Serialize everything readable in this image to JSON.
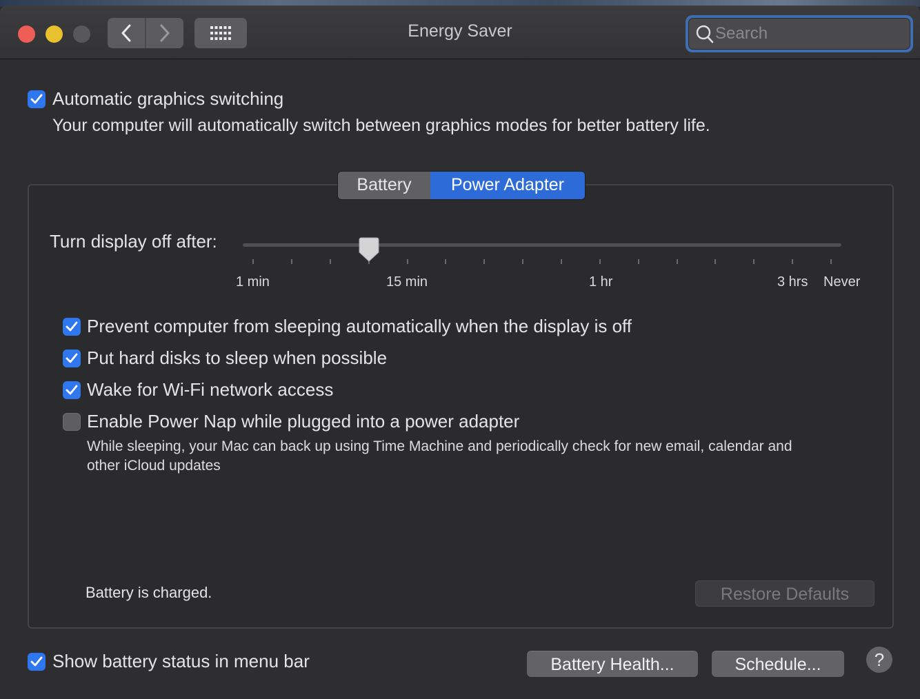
{
  "window": {
    "title": "Energy Saver",
    "search_placeholder": "Search"
  },
  "graphics": {
    "checked": true,
    "label": "Automatic graphics switching",
    "description": "Your computer will automatically switch between graphics modes for better battery life."
  },
  "tabs": [
    {
      "label": "Battery",
      "selected": false
    },
    {
      "label": "Power Adapter",
      "selected": true
    }
  ],
  "display_slider": {
    "label": "Turn display off after:",
    "tick_labels": [
      "1 min",
      "15 min",
      "1 hr",
      "3 hrs",
      "Never"
    ],
    "value": "15 min"
  },
  "options": [
    {
      "label": "Prevent computer from sleeping automatically when the display is off",
      "checked": true
    },
    {
      "label": "Put hard disks to sleep when possible",
      "checked": true
    },
    {
      "label": "Wake for Wi-Fi network access",
      "checked": true
    },
    {
      "label": "Enable Power Nap while plugged into a power adapter",
      "checked": false,
      "description": "While sleeping, your Mac can back up using Time Machine and periodically check for new email, calendar and other iCloud updates"
    }
  ],
  "status_text": "Battery is charged.",
  "buttons": {
    "restore_defaults": "Restore Defaults",
    "battery_health": "Battery Health...",
    "schedule": "Schedule...",
    "help": "?"
  },
  "show_battery_status": {
    "checked": true,
    "label": "Show battery status in menu bar"
  },
  "colors": {
    "accent": "#2f77ee",
    "close": "#ee5e56",
    "minimize": "#e9c02d"
  }
}
